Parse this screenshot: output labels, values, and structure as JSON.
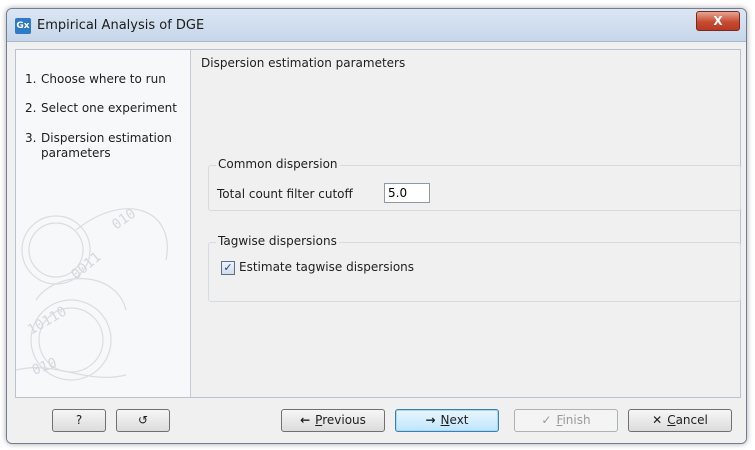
{
  "window": {
    "title": "Empirical Analysis of DGE",
    "app_icon_label": "Gx",
    "close_glyph": "X"
  },
  "steps": [
    {
      "num": "1.",
      "label": "Choose where to run"
    },
    {
      "num": "2.",
      "label": "Select one experiment"
    },
    {
      "num": "3.",
      "label_line1": "Dispersion estimation",
      "label_line2": "parameters"
    }
  ],
  "main": {
    "section_title": "Dispersion estimation parameters",
    "common_dispersion": {
      "group_label": "Common dispersion",
      "field_label": "Total count filter cutoff",
      "field_value": "5.0"
    },
    "tagwise": {
      "group_label": "Tagwise dispersions",
      "checkbox_label": "Estimate tagwise dispersions",
      "checked": true
    }
  },
  "footer": {
    "help_label": "?",
    "reset_icon": "↺",
    "previous": {
      "icon": "←",
      "mnemonic": "P",
      "rest": "revious"
    },
    "next": {
      "icon": "→",
      "mnemonic": "N",
      "rest": "ext"
    },
    "finish": {
      "icon": "✓",
      "mnemonic": "F",
      "rest": "inish"
    },
    "cancel": {
      "icon": "✕",
      "mnemonic": "C",
      "rest": "ancel"
    }
  },
  "colors": {
    "titlebar": "#c6d6ea",
    "close_button": "#c74b32",
    "default_button": "#bee6fd"
  }
}
